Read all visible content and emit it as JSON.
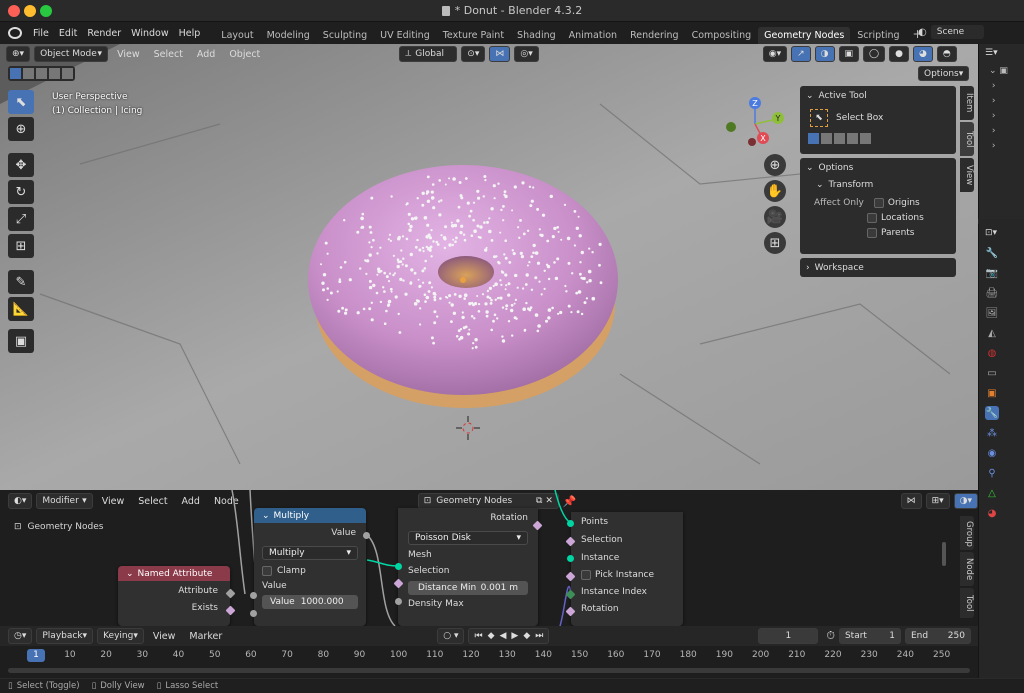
{
  "window": {
    "title": "* Donut - Blender 4.3.2"
  },
  "menu": {
    "file": "File",
    "edit": "Edit",
    "render": "Render",
    "window": "Window",
    "help": "Help"
  },
  "workspaces": [
    "Layout",
    "Modeling",
    "Sculpting",
    "UV Editing",
    "Texture Paint",
    "Shading",
    "Animation",
    "Rendering",
    "Compositing",
    "Geometry Nodes",
    "Scripting"
  ],
  "active_workspace": "Geometry Nodes",
  "scene": {
    "name": "Scene"
  },
  "viewport": {
    "mode": "Object Mode",
    "menus": {
      "view": "View",
      "select": "Select",
      "add": "Add",
      "object": "Object"
    },
    "orientation": "Global",
    "options": "Options",
    "overlay_line1": "User Perspective",
    "overlay_line2": "(1) Collection | Icing",
    "gizmo": {
      "x": "X",
      "y": "Y",
      "z": "Z"
    },
    "active_tool_panel": {
      "title": "Active Tool",
      "tool": "Select Box"
    },
    "options_panel": {
      "title": "Options",
      "transform": "Transform",
      "affect_only": "Affect Only",
      "origins": "Origins",
      "locations": "Locations",
      "parents": "Parents"
    },
    "workspace_panel": "Workspace",
    "side_tabs": {
      "item": "Item",
      "tool": "Tool",
      "view": "View"
    }
  },
  "node_editor": {
    "editor_type": "Modifier",
    "menus": {
      "view": "View",
      "select": "Select",
      "add": "Add",
      "node": "Node"
    },
    "tree_name": "Geometry Nodes",
    "breadcrumb": "Geometry Nodes",
    "side_tabs": {
      "group": "Group",
      "node": "Node",
      "tool": "Tool"
    },
    "named_attribute": {
      "title": "Named Attribute",
      "attribute": "Attribute",
      "exists": "Exists"
    },
    "multiply": {
      "title": "Multiply",
      "out": "Value",
      "op": "Multiply",
      "clamp": "Clamp",
      "in_value": "Value",
      "value_label": "Value",
      "value": "1000.000"
    },
    "distribute": {
      "mesh": "Mesh",
      "selection": "Selection",
      "method": "Poisson Disk",
      "distance_label": "Distance Min",
      "distance_value": "0.001 m",
      "density": "Density Max",
      "rotation_out": "Rotation"
    },
    "instance": {
      "points": "Points",
      "selection": "Selection",
      "instance": "Instance",
      "pick": "Pick Instance",
      "index": "Instance Index",
      "rotation": "Rotation"
    }
  },
  "timeline": {
    "playback": "Playback",
    "keying": "Keying",
    "view": "View",
    "marker": "Marker",
    "current_frame": "1",
    "start_label": "Start",
    "start": "1",
    "end_label": "End",
    "end": "250",
    "ticks": [
      "1",
      "10",
      "20",
      "30",
      "40",
      "50",
      "60",
      "70",
      "80",
      "90",
      "100",
      "110",
      "120",
      "130",
      "140",
      "150",
      "160",
      "170",
      "180",
      "190",
      "200",
      "210",
      "220",
      "230",
      "240",
      "250"
    ]
  },
  "statusbar": {
    "select": "Select (Toggle)",
    "dolly": "Dolly View",
    "lasso": "Lasso Select"
  },
  "colors": {
    "accent": "#4772b3",
    "node_named_attr": "#8b3a4a",
    "node_math": "#2f5f8a",
    "socket_geo": "#00d6a3",
    "socket_float": "#a1a1a1",
    "socket_vector": "#6363c7",
    "socket_bool": "#cca6d6",
    "donut_icing": "#c98fc9"
  }
}
